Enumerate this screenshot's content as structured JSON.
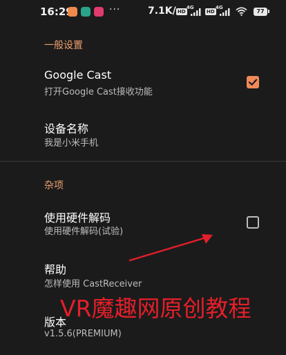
{
  "status_bar": {
    "time": "16:29",
    "dots": "···",
    "net_speed": "7.1K/s",
    "sim1_tag": "HD",
    "sim1_net": "4G",
    "sim2_tag": "HD",
    "sim2_net": "4G",
    "battery": "77"
  },
  "sections": {
    "general": {
      "header": "一般设置",
      "google_cast": {
        "title": "Google Cast",
        "summary": "打开Google Cast接收功能",
        "checked": true
      },
      "device_name": {
        "title": "设备名称",
        "summary": "我是小米手机"
      }
    },
    "misc": {
      "header": "杂项",
      "hw_decode": {
        "title": "使用硬件解码",
        "summary": "使用硬件解码(试验)",
        "checked": false
      },
      "help": {
        "title": "帮助",
        "summary": "怎样使用 CastReceiver"
      },
      "version": {
        "title": "版本",
        "summary": "v1.5.6(PREMIUM)"
      }
    }
  },
  "watermark": "VR魔趣网原创教程",
  "colors": {
    "background": "#1b1b1b",
    "accent": "#f08a5a",
    "section_header": "#f0a070",
    "watermark": "#e41f2a",
    "arrow": "#e41f2a"
  }
}
